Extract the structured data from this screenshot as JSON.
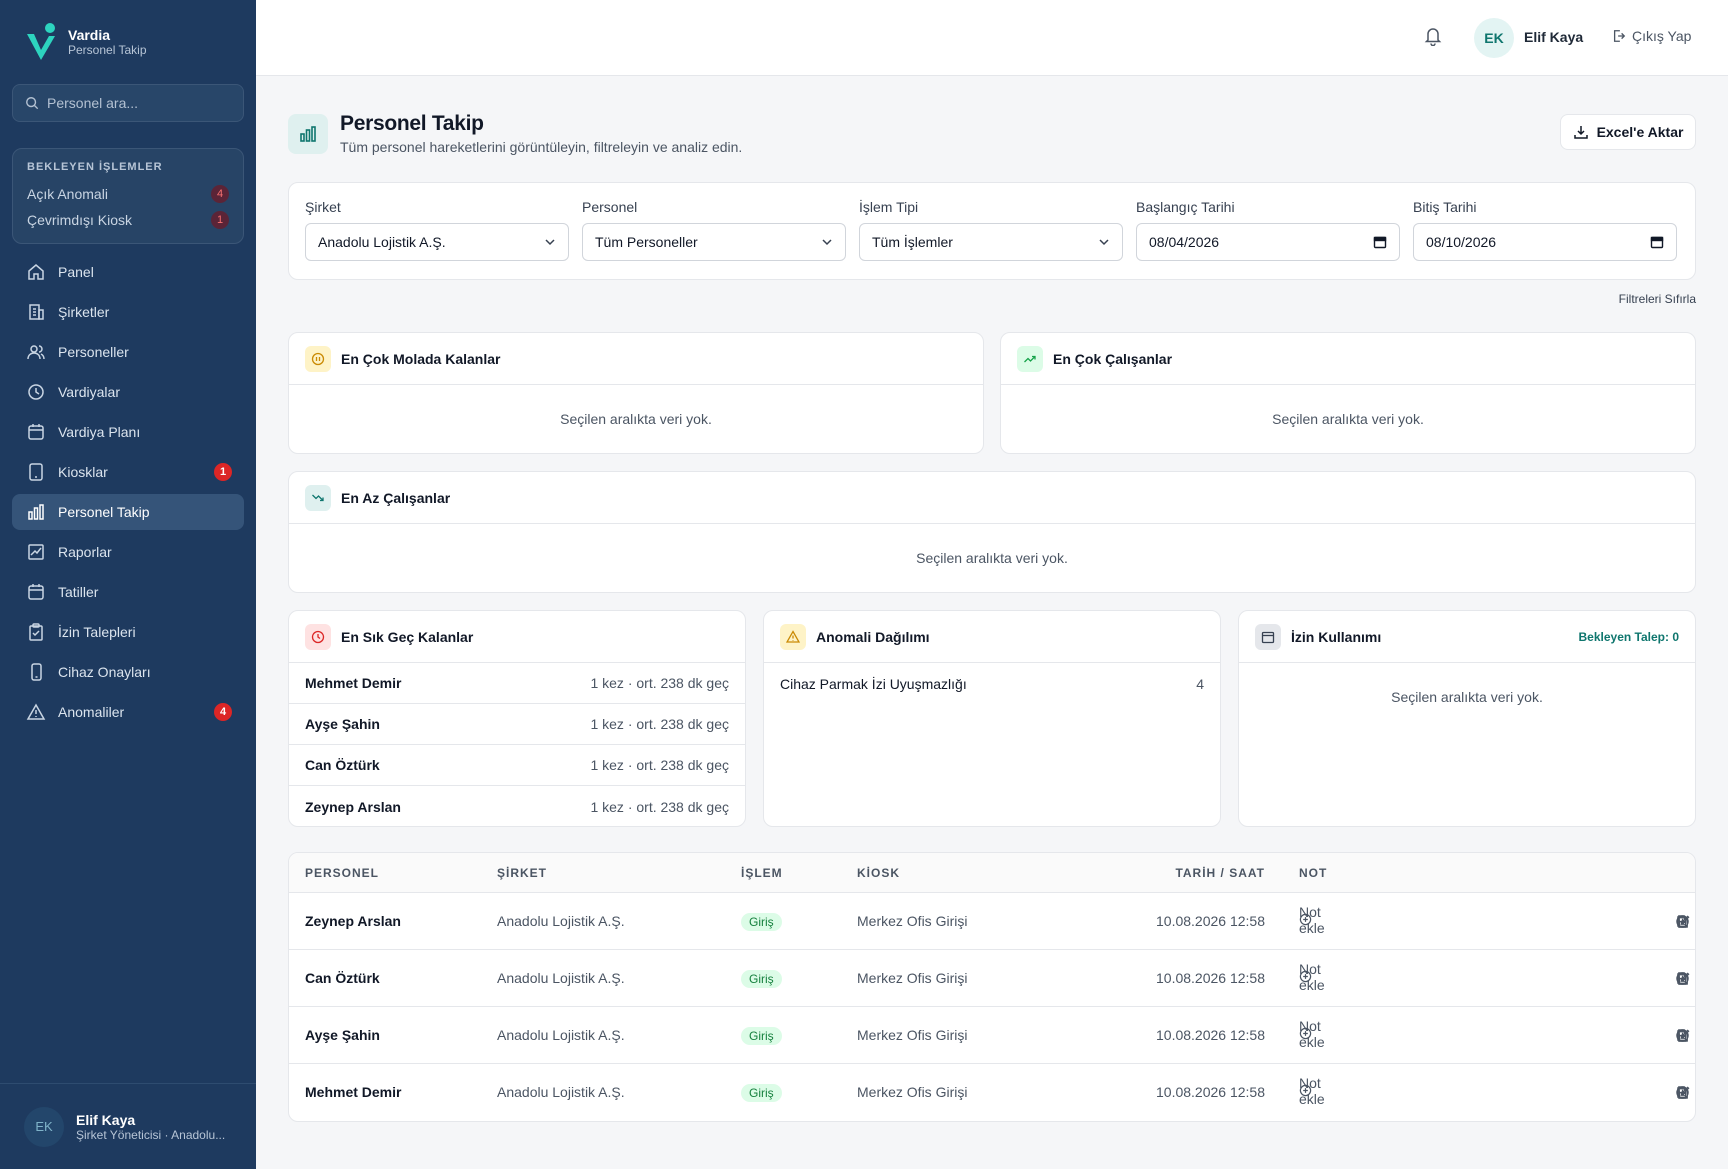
{
  "brand": {
    "title": "Vardia",
    "subtitle": "Personel Takip"
  },
  "sidebar": {
    "search_placeholder": "Personel ara...",
    "pending": {
      "title": "BEKLEYEN İŞLEMLER",
      "items": [
        {
          "label": "Açık Anomali",
          "count": "4"
        },
        {
          "label": "Çevrimdışı Kiosk",
          "count": "1"
        }
      ]
    },
    "nav": [
      {
        "label": "Panel",
        "icon": "home-icon"
      },
      {
        "label": "Şirketler",
        "icon": "building-icon"
      },
      {
        "label": "Personeller",
        "icon": "users-icon"
      },
      {
        "label": "Vardiyalar",
        "icon": "clock-icon"
      },
      {
        "label": "Vardiya Planı",
        "icon": "calendar-icon"
      },
      {
        "label": "Kiosklar",
        "icon": "tablet-icon",
        "badge": "1"
      },
      {
        "label": "Personel Takip",
        "icon": "bar-chart-icon",
        "active": true
      },
      {
        "label": "Raporlar",
        "icon": "report-chart-icon"
      },
      {
        "label": "Tatiller",
        "icon": "calendar-icon"
      },
      {
        "label": "İzin Talepleri",
        "icon": "clipboard-icon"
      },
      {
        "label": "Cihaz Onayları",
        "icon": "phone-icon"
      },
      {
        "label": "Anomaliler",
        "icon": "warning-icon",
        "badge": "4"
      }
    ],
    "user": {
      "initials": "EK",
      "name": "Elif Kaya",
      "role": "Şirket Yöneticisi · Anadolu..."
    }
  },
  "topbar": {
    "initials": "EK",
    "name": "Elif Kaya",
    "logout": "Çıkış Yap"
  },
  "page": {
    "title": "Personel Takip",
    "subtitle": "Tüm personel hareketlerini görüntüleyin, filtreleyin ve analiz edin.",
    "export_label": "Excel'e Aktar"
  },
  "filters": {
    "company": {
      "label": "Şirket",
      "value": "Anadolu Lojistik A.Ş."
    },
    "personnel": {
      "label": "Personel",
      "value": "Tüm Personeller"
    },
    "type": {
      "label": "İşlem Tipi",
      "value": "Tüm İşlemler"
    },
    "start": {
      "label": "Başlangıç Tarihi",
      "value": "08/04/2026"
    },
    "end": {
      "label": "Bitiş Tarihi",
      "value": "08/10/2026"
    },
    "reset": "Filtreleri Sıfırla"
  },
  "cards": {
    "most_break": {
      "title": "En Çok Molada Kalanlar",
      "empty": "Seçilen aralıkta veri yok."
    },
    "most_work": {
      "title": "En Çok Çalışanlar",
      "empty": "Seçilen aralıkta veri yok."
    },
    "least_work": {
      "title": "En Az Çalışanlar",
      "empty": "Seçilen aralıkta veri yok."
    },
    "late": {
      "title": "En Sık Geç Kalanlar",
      "rows": [
        {
          "name": "Mehmet Demir",
          "value": "1 kez · ort. 238 dk geç"
        },
        {
          "name": "Ayşe Şahin",
          "value": "1 kez · ort. 238 dk geç"
        },
        {
          "name": "Can Öztürk",
          "value": "1 kez · ort. 238 dk geç"
        },
        {
          "name": "Zeynep Arslan",
          "value": "1 kez · ort. 238 dk geç"
        }
      ]
    },
    "anomaly": {
      "title": "Anomali Dağılımı",
      "rows": [
        {
          "name": "Cihaz Parmak İzi Uyuşmazlığı",
          "value": "4"
        }
      ]
    },
    "leave": {
      "title": "İzin Kullanımı",
      "pending": "Bekleyen Talep: 0",
      "empty": "Seçilen aralıkta veri yok."
    }
  },
  "table": {
    "headers": {
      "name": "PERSONEL",
      "company": "ŞİRKET",
      "op": "İŞLEM",
      "kiosk": "KİOSK",
      "date": "TARİH / SAAT",
      "note": "NOT"
    },
    "rows": [
      {
        "name": "Zeynep Arslan",
        "company": "Anadolu Lojistik A.Ş.",
        "op": "Giriş",
        "kiosk": "Merkez Ofis Girişi",
        "date": "10.08.2026 12:58",
        "note": "Not ekle"
      },
      {
        "name": "Can Öztürk",
        "company": "Anadolu Lojistik A.Ş.",
        "op": "Giriş",
        "kiosk": "Merkez Ofis Girişi",
        "date": "10.08.2026 12:58",
        "note": "Not ekle"
      },
      {
        "name": "Ayşe Şahin",
        "company": "Anadolu Lojistik A.Ş.",
        "op": "Giriş",
        "kiosk": "Merkez Ofis Girişi",
        "date": "10.08.2026 12:58",
        "note": "Not ekle"
      },
      {
        "name": "Mehmet Demir",
        "company": "Anadolu Lojistik A.Ş.",
        "op": "Giriş",
        "kiosk": "Merkez Ofis Girişi",
        "date": "10.08.2026 12:58",
        "note": "Not ekle"
      }
    ]
  },
  "colors": {
    "sidebar": "#1e3a5f",
    "accent": "#0f766e",
    "badge": "#dc2626",
    "success": "#15803d"
  }
}
